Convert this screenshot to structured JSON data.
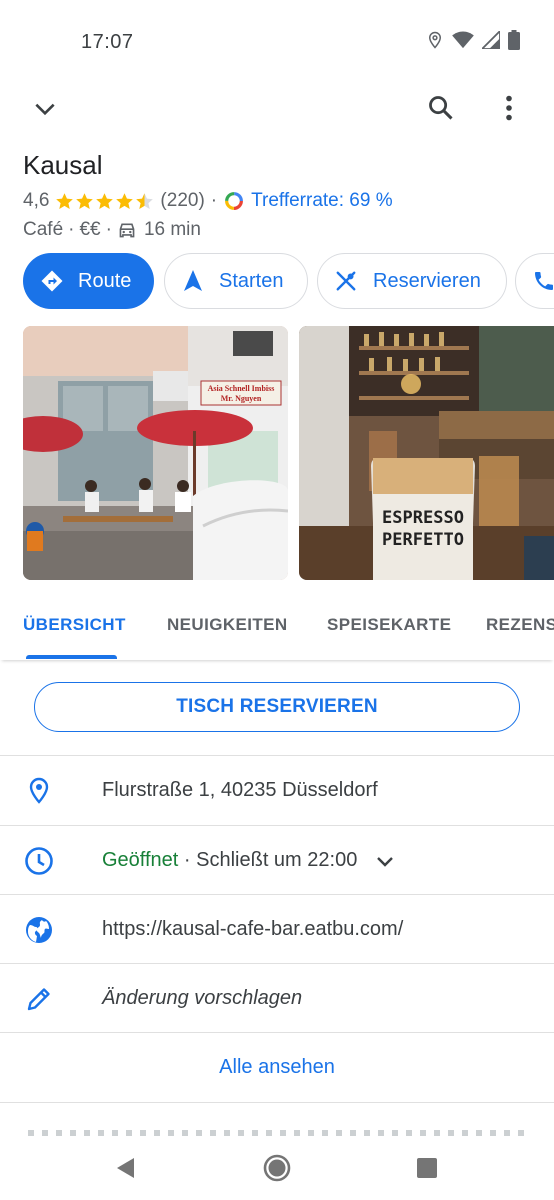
{
  "status_bar": {
    "time": "17:07",
    "icons": [
      "location-icon",
      "wifi-icon",
      "signal-icon",
      "battery-icon"
    ]
  },
  "top_bar": {
    "icons": [
      "chevron-down-icon",
      "search-icon",
      "more-vert-icon"
    ]
  },
  "place": {
    "name": "Kausal",
    "rating": "4,6",
    "stars": 4.5,
    "reviews": "(220)",
    "separator": "·",
    "match_label": "Trefferrate: 69 %",
    "category": "Café",
    "price": "€€",
    "drive_time": "16 min"
  },
  "actions": {
    "route": "Route",
    "start": "Starten",
    "reserve": "Reservieren"
  },
  "tabs": [
    {
      "label": "ÜBERSICHT",
      "active": true
    },
    {
      "label": "NEUIGKEITEN",
      "active": false
    },
    {
      "label": "SPEISEKARTE",
      "active": false
    },
    {
      "label": "REZENSIONEN",
      "active": false
    }
  ],
  "reserve_button": "TISCH RESERVIEREN",
  "info": {
    "address": "Flurstraße 1, 40235 Düsseldorf",
    "hours_status": "Geöffnet",
    "hours_detail": " · Schließt um 22:00",
    "website": "https://kausal-cafe-bar.eatbu.com/",
    "suggest_edit": "Änderung vorschlagen"
  },
  "see_all": "Alle ansehen",
  "photos": {
    "photo1_sign_line1": "Asia Schnell Imbiss",
    "photo1_sign_line2": "Mr. Nguyen",
    "photo2_cup_line1": "ESPRESSO",
    "photo2_cup_line2": "PERFETTO"
  },
  "colors": {
    "accent": "#1a73e8",
    "open_green": "#188038",
    "star": "#fbbc04"
  }
}
